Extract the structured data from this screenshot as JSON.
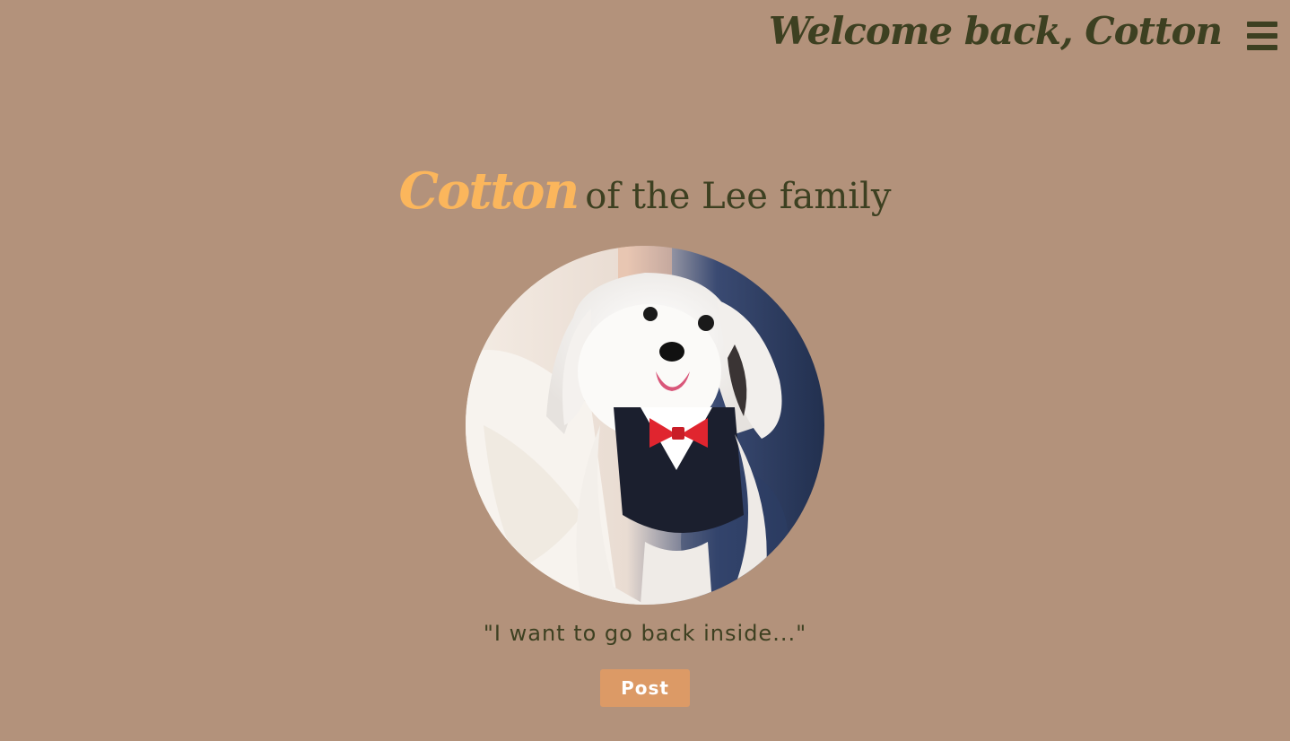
{
  "header": {
    "welcome_text": "Welcome back, Cotton",
    "menu_icon": "hamburger-menu-icon"
  },
  "profile": {
    "pet_name": "Cotton",
    "family_text": "of the Lee family",
    "quote": "\"I want to go back inside...\"",
    "post_label": "Post"
  },
  "colors": {
    "background": "#b3927b",
    "text_dark": "#3d4021",
    "accent_name": "#fbb65c",
    "button": "#dc9a66"
  }
}
